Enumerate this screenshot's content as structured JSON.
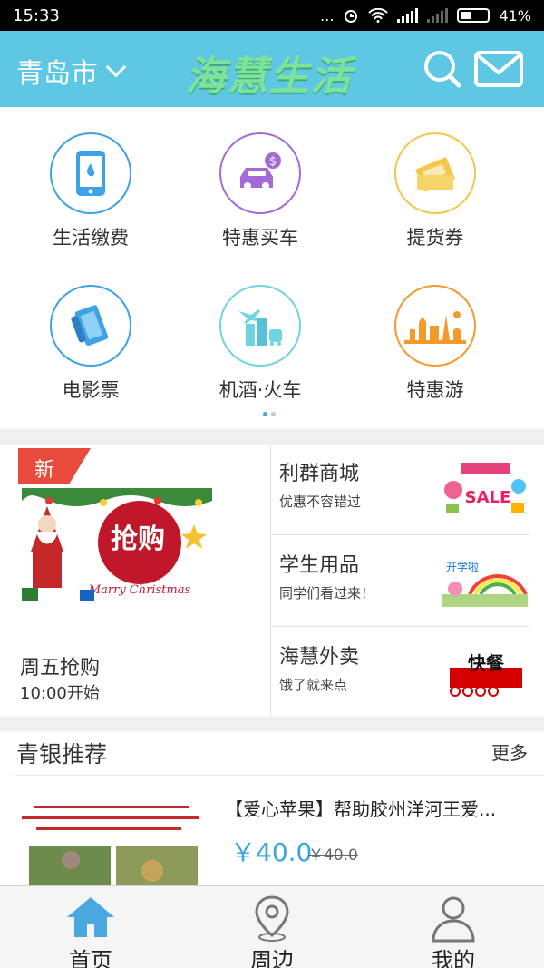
{
  "status_bar": {
    "time": "15:33",
    "dots": "...",
    "battery": "41%"
  },
  "header": {
    "city": "青岛市",
    "logo": "海慧生活"
  },
  "services": [
    {
      "label": "生活缴费",
      "icon": "phone-payment-icon",
      "color": "#3fa1e6"
    },
    {
      "label": "特惠买车",
      "icon": "car-icon",
      "color": "#a46ad8"
    },
    {
      "label": "提货券",
      "icon": "voucher-icon",
      "color": "#f3c74a"
    },
    {
      "label": "电影票",
      "icon": "film-icon",
      "color": "#3fa1e6"
    },
    {
      "label": "机酒·火车",
      "icon": "travel-city-icon",
      "color": "#6fd3e0"
    },
    {
      "label": "特惠游",
      "icon": "landmarks-icon",
      "color": "#f39a2b"
    }
  ],
  "promo": {
    "badge": "新",
    "flash_sale": {
      "image_text": "抢购",
      "image_caption": "Marry Christmas",
      "title": "周五抢购",
      "time": "10:00开始"
    },
    "shops": [
      {
        "title": "利群商城",
        "subtitle": "优惠不容错过",
        "image_text": "SALE"
      },
      {
        "title": "学生用品",
        "subtitle": "同学们看过来！",
        "image_text": "开学啦"
      },
      {
        "title": "海慧外卖",
        "subtitle": "饿了就来点",
        "image_text": "快餐"
      }
    ]
  },
  "recommend": {
    "title": "青银推荐",
    "more": "更多",
    "item": {
      "name": "【爱心苹果】帮助胶州洋河王爱...",
      "price": "￥40.0",
      "old_price": "￥40.0"
    }
  },
  "nav": [
    {
      "label": "首页",
      "icon": "home-icon",
      "active": true
    },
    {
      "label": "周边",
      "icon": "location-pin-icon",
      "active": false
    },
    {
      "label": "我的",
      "icon": "user-icon",
      "active": false
    }
  ],
  "colors": {
    "accent": "#5ec8e4",
    "price": "#3aa7e2",
    "badge": "#e84b3c"
  }
}
